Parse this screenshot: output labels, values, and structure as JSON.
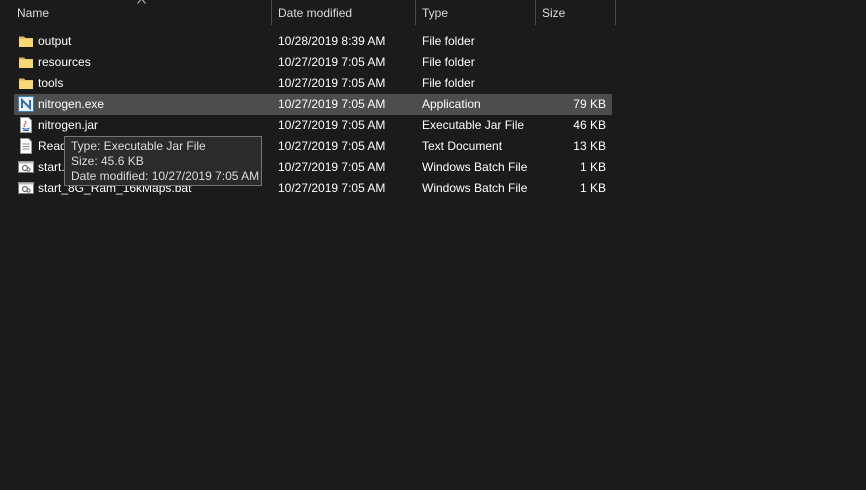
{
  "columns": {
    "name": "Name",
    "date": "Date modified",
    "type": "Type",
    "size": "Size"
  },
  "files": [
    {
      "name": "output",
      "date": "10/28/2019 8:39 AM",
      "type": "File folder",
      "size": "",
      "icon": "folder-icon"
    },
    {
      "name": "resources",
      "date": "10/27/2019 7:05 AM",
      "type": "File folder",
      "size": "",
      "icon": "folder-icon"
    },
    {
      "name": "tools",
      "date": "10/27/2019 7:05 AM",
      "type": "File folder",
      "size": "",
      "icon": "folder-icon"
    },
    {
      "name": "nitrogen.exe",
      "date": "10/27/2019 7:05 AM",
      "type": "Application",
      "size": "79 KB",
      "icon": "application-icon",
      "selected": true
    },
    {
      "name": "nitrogen.jar",
      "date": "10/27/2019 7:05 AM",
      "type": "Executable Jar File",
      "size": "46 KB",
      "icon": "jar-icon"
    },
    {
      "name": "Readme.txt",
      "date": "10/27/2019 7:05 AM",
      "type": "Text Document",
      "size": "13 KB",
      "icon": "text-document-icon"
    },
    {
      "name": "start.bat",
      "date": "10/27/2019 7:05 AM",
      "type": "Windows Batch File",
      "size": "1 KB",
      "icon": "batch-file-icon"
    },
    {
      "name": "start_8G_Ram_16kMaps.bat",
      "date": "10/27/2019 7:05 AM",
      "type": "Windows Batch File",
      "size": "1 KB",
      "icon": "batch-file-icon"
    }
  ],
  "tooltip": {
    "type_line": "Type: Executable Jar File",
    "size_line": "Size: 45.6 KB",
    "date_line": "Date modified: 10/27/2019 7:05 AM"
  },
  "colors": {
    "background": "#1b1b1b",
    "selected_row": "#4d4d4d",
    "folder": "#f8d775",
    "text": "#ffffff"
  }
}
